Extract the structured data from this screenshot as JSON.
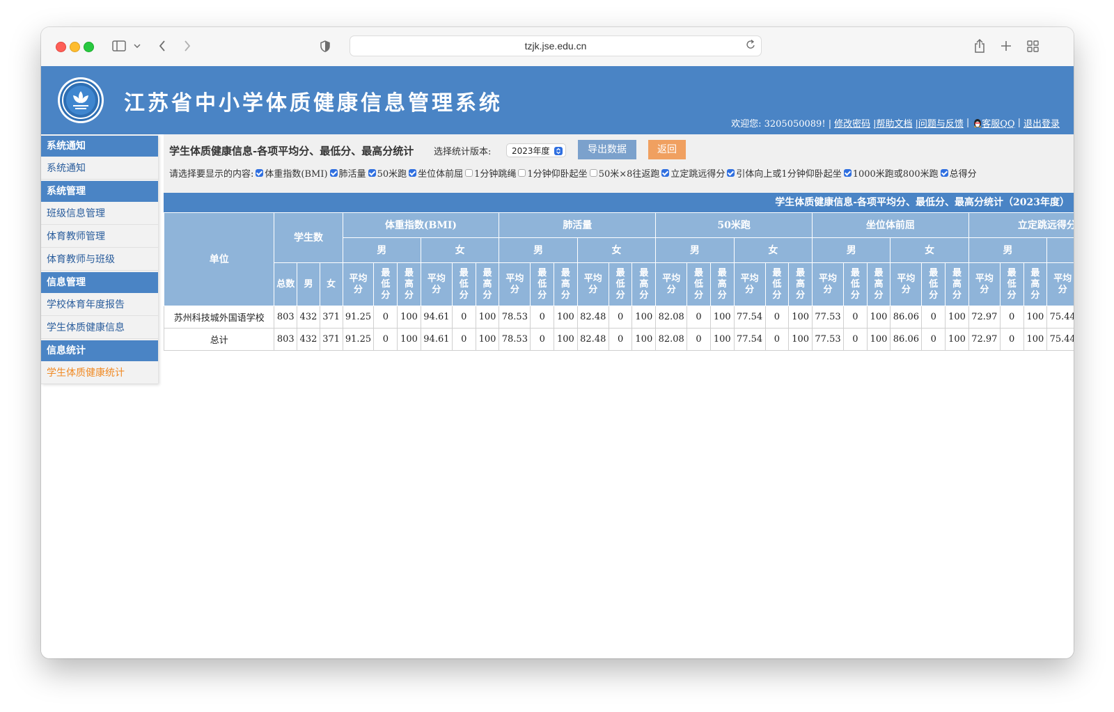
{
  "browser": {
    "url": "tzjk.jse.edu.cn"
  },
  "header": {
    "title": "江苏省中小学体质健康信息管理系统",
    "welcome": "欢迎您: 3205050089! |",
    "links": [
      "修改密码",
      "|帮助文档",
      "|问题与反馈",
      "|",
      "客服QQ",
      "|",
      "退出登录"
    ]
  },
  "sidebar": {
    "sections": [
      {
        "head": "系统通知",
        "items": [
          "系统通知"
        ]
      },
      {
        "head": "系统管理",
        "items": [
          "班级信息管理",
          "体育教师管理",
          "体育教师与班级"
        ]
      },
      {
        "head": "信息管理",
        "items": [
          "学校体育年度报告",
          "学生体质健康信息"
        ]
      },
      {
        "head": "信息统计",
        "items": [
          "学生体质健康统计"
        ]
      }
    ],
    "active": "学生体质健康统计"
  },
  "controls": {
    "title": "学生体质健康信息-各项平均分、最低分、最高分统计",
    "version_label": "选择统计版本:",
    "version_value": "2023年度",
    "export_label": "导出数据",
    "back_label": "返回",
    "show_label": "请选择要显示的内容:",
    "options": [
      {
        "label": "体重指数(BMI)",
        "checked": true
      },
      {
        "label": "肺活量",
        "checked": true
      },
      {
        "label": "50米跑",
        "checked": true
      },
      {
        "label": "坐位体前屈",
        "checked": true
      },
      {
        "label": "1分钟跳绳",
        "checked": false
      },
      {
        "label": "1分钟仰卧起坐",
        "checked": false
      },
      {
        "label": "50米×8往返跑",
        "checked": false
      },
      {
        "label": "立定跳远得分",
        "checked": true
      },
      {
        "label": "引体向上或1分钟仰卧起坐",
        "checked": true
      },
      {
        "label": "1000米跑或800米跑",
        "checked": true
      },
      {
        "label": "总得分",
        "checked": true
      }
    ]
  },
  "table": {
    "caption": "学生体质健康信息-各项平均分、最低分、最高分统计（2023年度）",
    "unit_header": "单位",
    "count_header": "学生数",
    "count_sub": [
      "总数",
      "男",
      "女"
    ],
    "test_items": [
      "体重指数(BMI)",
      "肺活量",
      "50米跑",
      "坐位体前屈",
      "立定跳远得分"
    ],
    "genders": [
      "男",
      "女"
    ],
    "stat_headers": [
      "平均分",
      "最低分",
      "最高分"
    ],
    "rows": [
      {
        "unit": "苏州科技城外国语学校",
        "counts": [
          "803",
          "432",
          "371"
        ],
        "stats": [
          "91.25",
          "0",
          "100",
          "94.61",
          "0",
          "100",
          "78.53",
          "0",
          "100",
          "82.48",
          "0",
          "100",
          "82.08",
          "0",
          "100",
          "77.54",
          "0",
          "100",
          "77.53",
          "0",
          "100",
          "86.06",
          "0",
          "100",
          "72.97",
          "0",
          "100",
          "75.44"
        ]
      },
      {
        "unit": "总计",
        "counts": [
          "803",
          "432",
          "371"
        ],
        "stats": [
          "91.25",
          "0",
          "100",
          "94.61",
          "0",
          "100",
          "78.53",
          "0",
          "100",
          "82.48",
          "0",
          "100",
          "82.08",
          "0",
          "100",
          "77.54",
          "0",
          "100",
          "77.53",
          "0",
          "100",
          "86.06",
          "0",
          "100",
          "72.97",
          "0",
          "100",
          "75.44"
        ]
      }
    ]
  },
  "colors": {
    "banner": "#4a84c5",
    "table_header": "#8fb4d9",
    "active_link": "#f08a24",
    "link": "#2a5d9c"
  }
}
